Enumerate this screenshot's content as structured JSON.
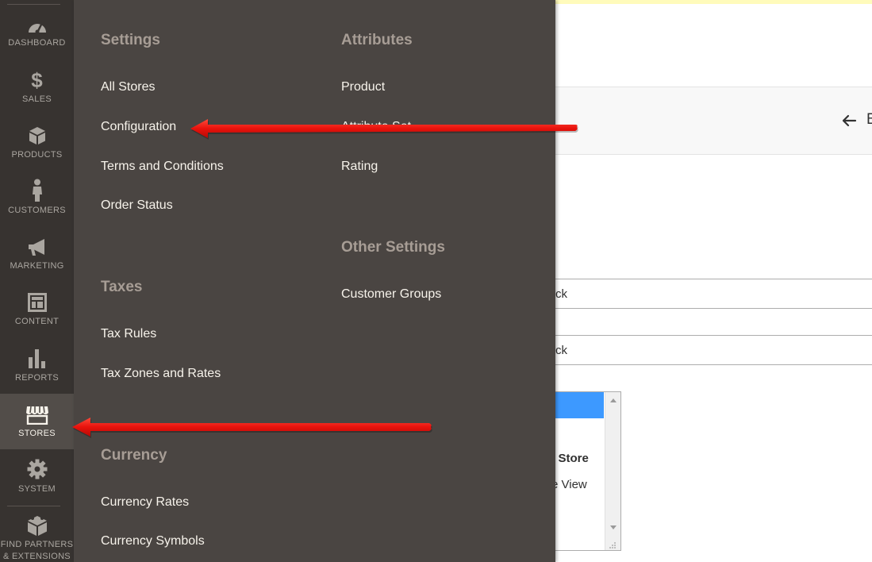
{
  "sidebar": {
    "items": [
      {
        "label": "DASHBOARD",
        "icon": "dashboard-icon"
      },
      {
        "label": "SALES",
        "icon": "dollar-icon"
      },
      {
        "label": "PRODUCTS",
        "icon": "box-icon"
      },
      {
        "label": "CUSTOMERS",
        "icon": "person-icon"
      },
      {
        "label": "MARKETING",
        "icon": "megaphone-icon"
      },
      {
        "label": "CONTENT",
        "icon": "layout-icon"
      },
      {
        "label": "REPORTS",
        "icon": "bar-chart-icon"
      },
      {
        "label": "STORES",
        "icon": "storefront-icon"
      },
      {
        "label": "SYSTEM",
        "icon": "gear-icon"
      },
      {
        "label_line1": "FIND PARTNERS",
        "label_line2": "& EXTENSIONS",
        "icon": "extensions-icon"
      }
    ],
    "active": "STORES"
  },
  "flyout": {
    "settings": {
      "title": "Settings",
      "links": [
        "All Stores",
        "Configuration",
        "Terms and Conditions",
        "Order Status"
      ]
    },
    "taxes": {
      "title": "Taxes",
      "links": [
        "Tax Rules",
        "Tax Zones and Rates"
      ]
    },
    "currency": {
      "title": "Currency",
      "links": [
        "Currency Rates",
        "Currency Symbols"
      ]
    },
    "attributes": {
      "title": "Attributes",
      "links": [
        "Product",
        "Attribute Set",
        "Rating"
      ]
    },
    "other_settings": {
      "title": "Other Settings",
      "links": [
        "Customer Groups"
      ]
    }
  },
  "background_page": {
    "header_back_label": "B",
    "field1_text": "ck",
    "field2_text": "ck",
    "list_option_bold": "e Store",
    "list_option": "e View"
  },
  "colors": {
    "sidebar_bg": "#373330",
    "sidebar_active_bg": "#524d49",
    "flyout_bg": "#4a4542",
    "section_title": "#a79d95",
    "link_text": "#f7f3eb",
    "annotation_arrow": "#e8120c"
  }
}
